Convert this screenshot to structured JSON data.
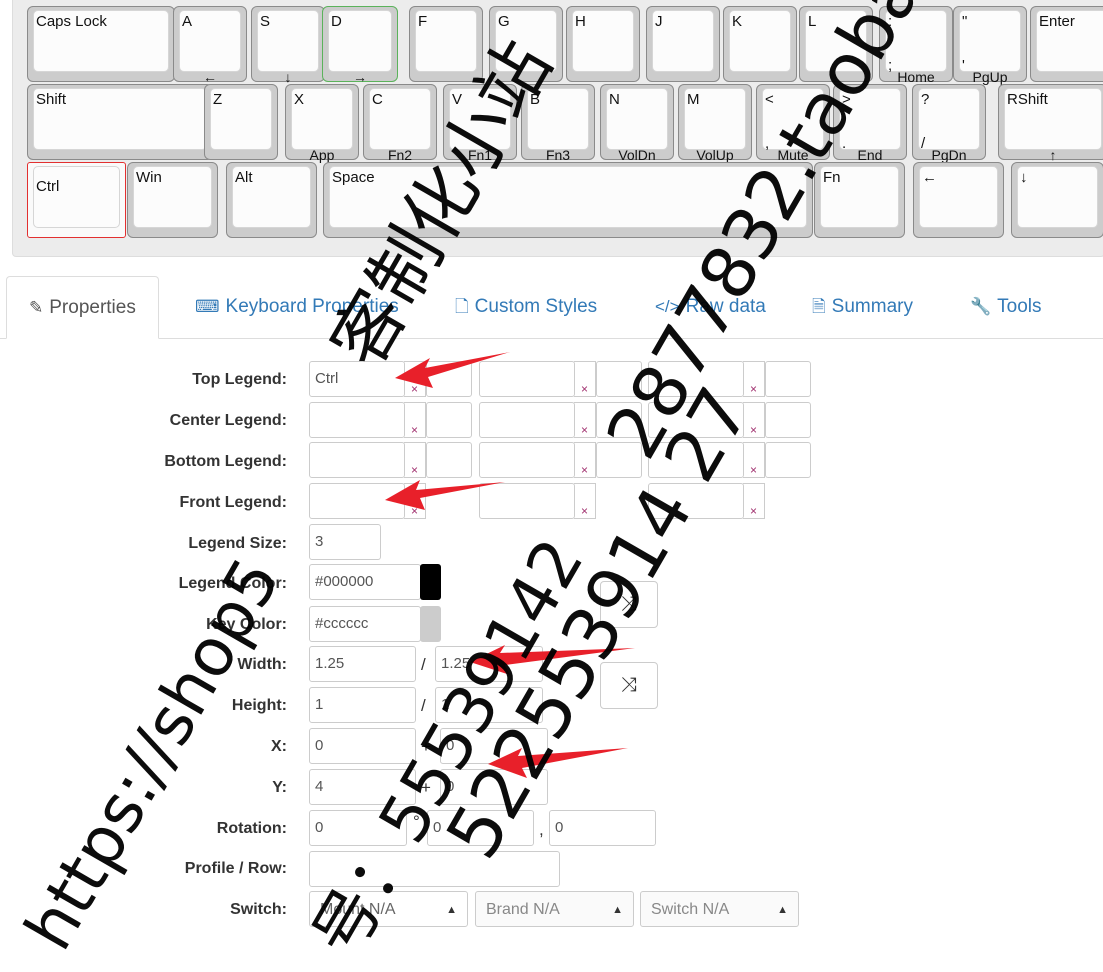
{
  "keyboard": {
    "row1": [
      {
        "top": "Caps Lock",
        "bottom": "",
        "front": ""
      },
      {
        "top": "A",
        "bottom": "",
        "front": "←"
      },
      {
        "top": "S",
        "bottom": "",
        "front": "↓"
      },
      {
        "top": "D",
        "bottom": "",
        "front": "→"
      },
      {
        "top": "F",
        "bottom": "",
        "front": ""
      },
      {
        "top": "G",
        "bottom": "",
        "front": ""
      },
      {
        "top": "H",
        "bottom": "",
        "front": ""
      },
      {
        "top": "J",
        "bottom": "",
        "front": ""
      },
      {
        "top": "K",
        "bottom": "",
        "front": ""
      },
      {
        "top": "L",
        "bottom": "",
        "front": ""
      },
      {
        "top": ":",
        "bottom": ";",
        "front": "Home"
      },
      {
        "top": "\"",
        "bottom": "'",
        "front": "PgUp"
      },
      {
        "top": "Enter",
        "bottom": "",
        "front": ""
      }
    ],
    "row2": [
      {
        "top": "Shift",
        "bottom": "",
        "front": ""
      },
      {
        "top": "Z",
        "bottom": "",
        "front": ""
      },
      {
        "top": "X",
        "bottom": "",
        "front": "App"
      },
      {
        "top": "C",
        "bottom": "",
        "front": "Fn2"
      },
      {
        "top": "V",
        "bottom": "",
        "front": "Fn1"
      },
      {
        "top": "B",
        "bottom": "",
        "front": "Fn3"
      },
      {
        "top": "N",
        "bottom": "",
        "front": "VolDn"
      },
      {
        "top": "M",
        "bottom": "",
        "front": "VolUp"
      },
      {
        "top": "<",
        "bottom": ",",
        "front": "Mute"
      },
      {
        "top": ">",
        "bottom": ".",
        "front": "End"
      },
      {
        "top": "?",
        "bottom": "/",
        "front": "PgDn"
      },
      {
        "top": "RShift",
        "bottom": "",
        "front": "↑"
      }
    ],
    "row3": [
      {
        "top": "Ctrl",
        "bottom": "",
        "front": ""
      },
      {
        "top": "Win",
        "bottom": "",
        "front": ""
      },
      {
        "top": "Alt",
        "bottom": "",
        "front": ""
      },
      {
        "top": "Space",
        "bottom": "",
        "front": ""
      },
      {
        "top": "Fn",
        "bottom": "",
        "front": ""
      },
      {
        "top": "←",
        "bottom": "",
        "front": ""
      },
      {
        "top": "↓",
        "bottom": "",
        "front": ""
      }
    ]
  },
  "tabs": [
    {
      "label": "Properties",
      "icon": "edit-icon",
      "active": true
    },
    {
      "label": "Keyboard Properties",
      "icon": "keyboard-icon",
      "active": false
    },
    {
      "label": "Custom Styles",
      "icon": "file-icon",
      "active": false
    },
    {
      "label": "Raw data",
      "icon": "code-icon",
      "active": false
    },
    {
      "label": "Summary",
      "icon": "file-text-icon",
      "active": false
    },
    {
      "label": "Tools",
      "icon": "wrench-icon",
      "active": false
    }
  ],
  "tab_icons": [
    "✎",
    "⌨",
    "🗋",
    "</>",
    "🗎",
    "🔧"
  ],
  "form": {
    "top_legend_label": "Top Legend:",
    "center_legend_label": "Center Legend:",
    "bottom_legend_label": "Bottom Legend:",
    "front_legend_label": "Front Legend:",
    "legend_size_label": "Legend Size:",
    "legend_color_label": "Legend Color:",
    "key_color_label": "Key Color:",
    "width_label": "Width:",
    "height_label": "Height:",
    "x_label": "X:",
    "y_label": "Y:",
    "rotation_label": "Rotation:",
    "profile_label": "Profile / Row:",
    "switch_label": "Switch:",
    "top_legend_value": "Ctrl",
    "legend_size_value": "3",
    "legend_color_value": "#000000",
    "key_color_value": "#cccccc",
    "width_value": "1.25",
    "width2_value": "1.25",
    "height_value": "1",
    "height2_value": "1",
    "x_value": "0",
    "x2_value": "0",
    "y_value": "4",
    "y2_value": "0",
    "rotation_value": "0",
    "rotation_x_value": "0",
    "rotation_y_value": "0",
    "profile_value": "",
    "clear_symbol": "×",
    "slash_symbol": "/",
    "plus_symbol": "+",
    "degree_symbol": "°",
    "comma_symbol": ",",
    "swap_symbol": "⤨",
    "switch_mount": "Mount N/A",
    "switch_brand": "Brand N/A",
    "switch_type": "Switch N/A",
    "caret_symbol": "▲"
  },
  "colors": {
    "legend_color": "#000000",
    "key_color": "#cccccc",
    "arrow_color": "#e8202a",
    "selected_key_border": "#e23030"
  },
  "watermark": {
    "line1": "客制化小站",
    "line2": "2877832.taoba",
    "line3": "522553914 27",
    "line4": "https://shop5",
    "line5": "号：55539142"
  }
}
